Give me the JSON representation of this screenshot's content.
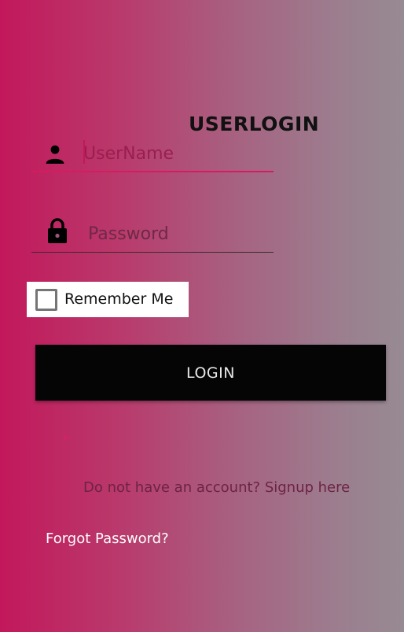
{
  "screen": {
    "title": "USERLOGIN"
  },
  "form": {
    "username": {
      "placeholder": "UserName",
      "value": "",
      "icon": "person-icon",
      "accent_color": "#d81b60"
    },
    "password": {
      "placeholder": "Password",
      "value": "",
      "icon": "lock-icon"
    },
    "remember_me": {
      "label": "Remember Me",
      "checked": false
    },
    "login_button_label": "LOGIN"
  },
  "links": {
    "signup": "Do not have an account? Signup here",
    "forgot_password": "Forgot Password?"
  },
  "colors": {
    "gradient_start": "#c2185b",
    "gradient_end": "#978a92",
    "button_bg": "#050505"
  }
}
